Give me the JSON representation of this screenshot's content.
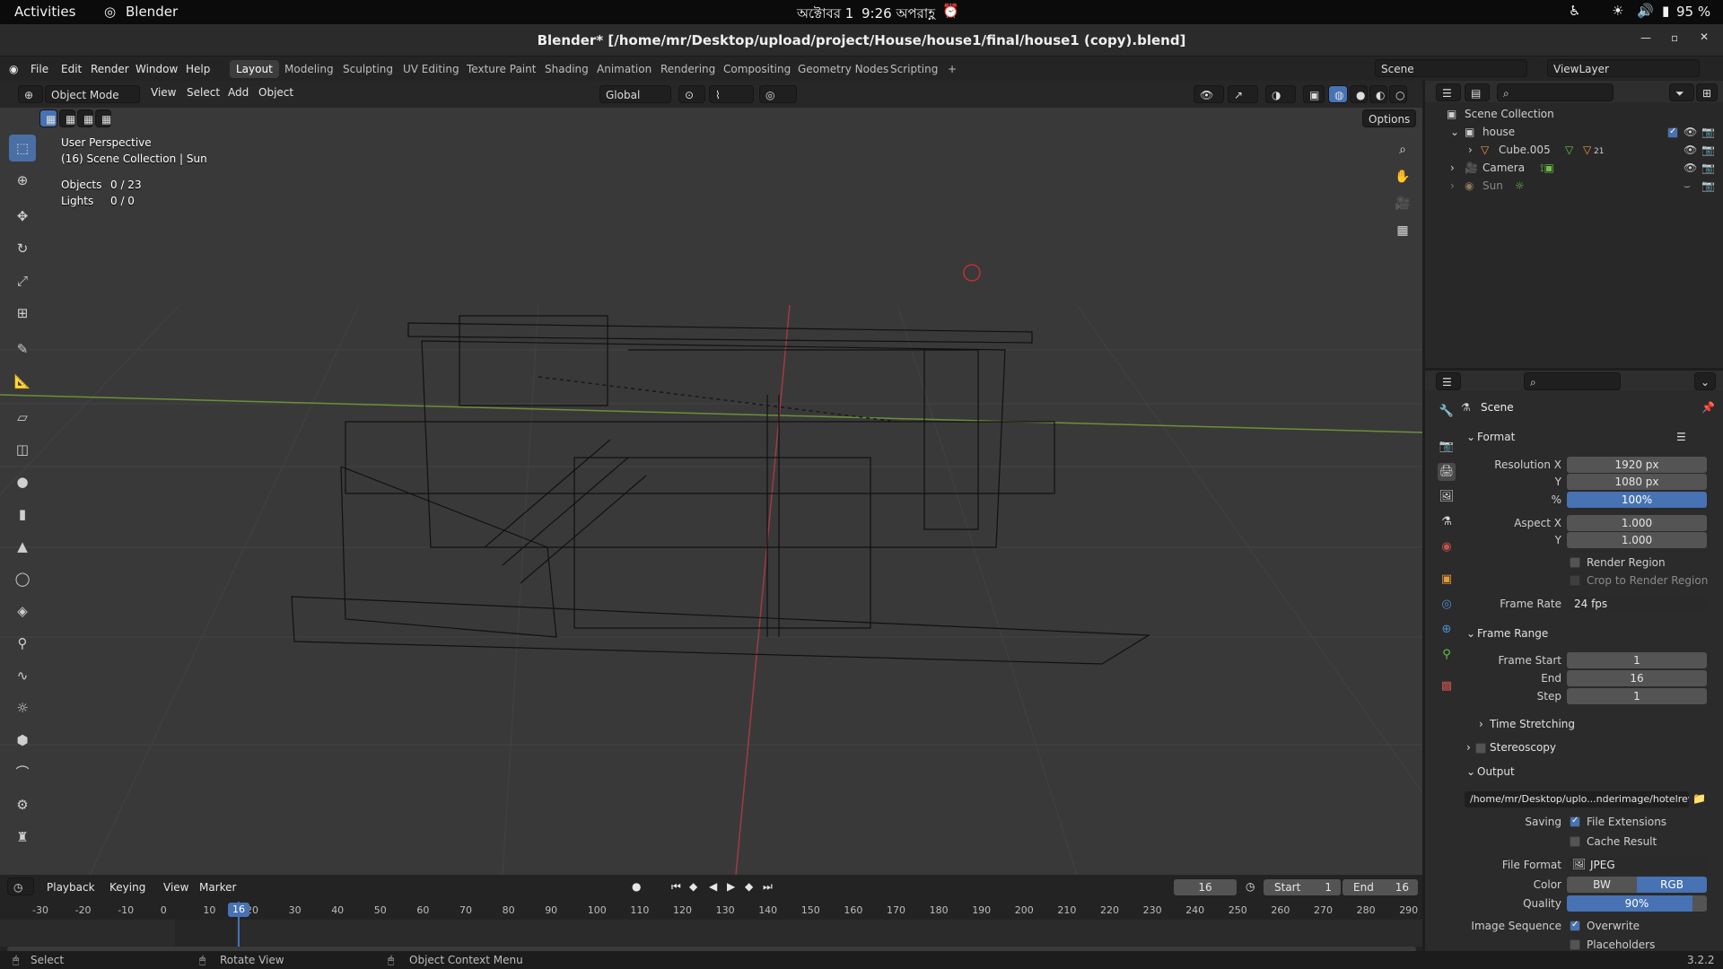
{
  "gnome": {
    "activities": "Activities",
    "app": "Blender",
    "date": "অক্টোবর 1",
    "time": "9:26 অপরাহ্ণ",
    "battery": "95 %"
  },
  "window": {
    "title": "Blender* [/home/mr/Desktop/upload/project/House/house1/final/house1 (copy).blend]"
  },
  "menu": {
    "file": "File",
    "edit": "Edit",
    "render": "Render",
    "window": "Window",
    "help": "Help"
  },
  "workspaces": [
    "Layout",
    "Modeling",
    "Sculpting",
    "UV Editing",
    "Texture Paint",
    "Shading",
    "Animation",
    "Rendering",
    "Compositing",
    "Geometry Nodes",
    "Scripting"
  ],
  "scene_field": "Scene",
  "viewlayer_field": "ViewLayer",
  "viewport": {
    "mode": "Object Mode",
    "view": "View",
    "select": "Select",
    "add": "Add",
    "object": "Object",
    "transform": "Global",
    "options": "Options",
    "perspective": "User Perspective",
    "collection_info": "(16) Scene Collection | Sun",
    "objects_label": "Objects",
    "objects_value": "0 / 23",
    "lights_label": "Lights",
    "lights_value": "0 / 0"
  },
  "outliner": {
    "root": "Scene Collection",
    "collection": "house",
    "items": [
      {
        "name": "Cube.005",
        "extra": "21"
      },
      {
        "name": "Camera"
      },
      {
        "name": "Sun"
      }
    ]
  },
  "properties": {
    "scene": "Scene",
    "format": {
      "header": "Format",
      "res_x_label": "Resolution X",
      "res_x": "1920 px",
      "res_y_label": "Y",
      "res_y": "1080 px",
      "pct_label": "%",
      "pct": "100%",
      "aspect_x_label": "Aspect X",
      "aspect_x": "1.000",
      "aspect_y_label": "Y",
      "aspect_y": "1.000",
      "render_region": "Render Region",
      "crop": "Crop to Render Region",
      "frame_rate_label": "Frame Rate",
      "frame_rate": "24 fps"
    },
    "frame_range": {
      "header": "Frame Range",
      "start_label": "Frame Start",
      "start": "1",
      "end_label": "End",
      "end": "16",
      "step_label": "Step",
      "step": "1"
    },
    "time_stretching": "Time Stretching",
    "stereoscopy": "Stereoscopy",
    "output": {
      "header": "Output",
      "path": "/home/mr/Desktop/uplo...nderimage/hotelreview",
      "saving_label": "Saving",
      "file_ext": "File Extensions",
      "cache": "Cache Result",
      "format_label": "File Format",
      "format": "JPEG",
      "color_label": "Color",
      "bw": "BW",
      "rgb": "RGB",
      "quality_label": "Quality",
      "quality": "90%",
      "quality_fraction": 0.9,
      "sequence_label": "Image Sequence",
      "overwrite": "Overwrite",
      "placeholders": "Placeholders"
    }
  },
  "timeline": {
    "playback": "Playback",
    "keying": "Keying",
    "view": "View",
    "marker": "Marker",
    "current": "16",
    "start_label": "Start",
    "start": "1",
    "end_label": "End",
    "end": "16",
    "ticks": [
      "-30",
      "-20",
      "-10",
      "0",
      "10",
      "20",
      "30",
      "40",
      "50",
      "60",
      "70",
      "80",
      "90",
      "100",
      "110",
      "120",
      "130",
      "140",
      "150",
      "160",
      "170",
      "180",
      "190",
      "200",
      "210",
      "220",
      "230",
      "240",
      "250",
      "260",
      "270",
      "280",
      "290"
    ]
  },
  "status": {
    "select": "Select",
    "rotate": "Rotate View",
    "context": "Object Context Menu",
    "version": "3.2.2"
  }
}
